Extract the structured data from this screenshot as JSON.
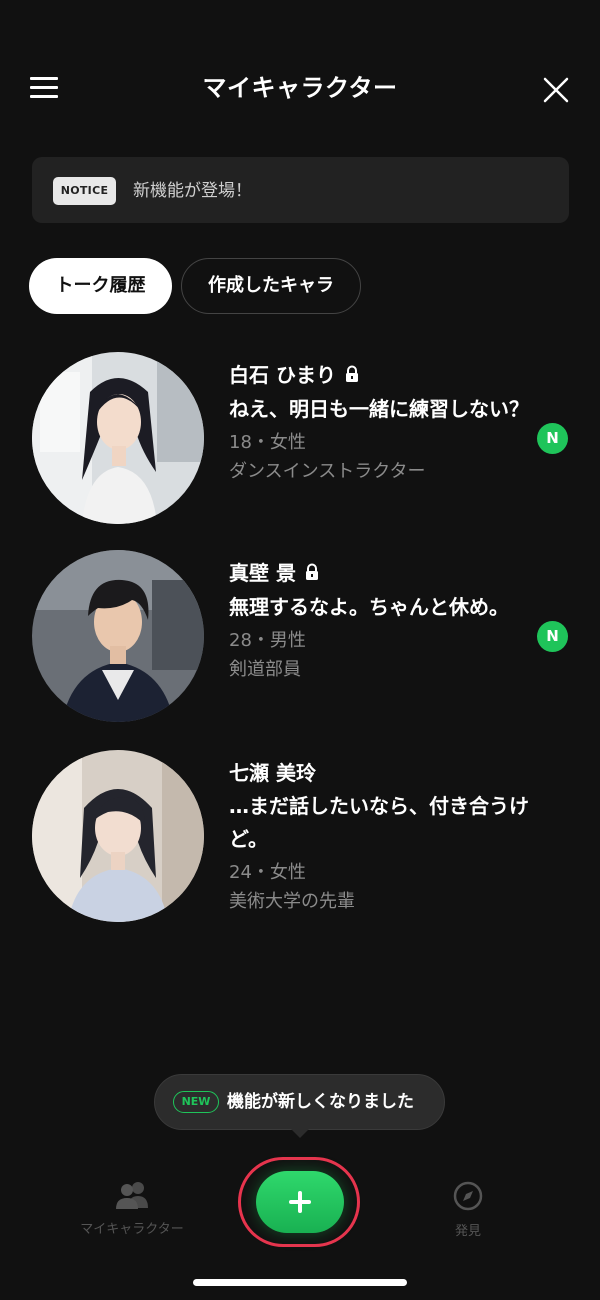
{
  "header": {
    "title": "マイキャラクター",
    "menu_icon": "hamburger-menu-icon",
    "close_icon": "close-icon"
  },
  "notice": {
    "badge": "NOTICE",
    "text": "新機能が登場！"
  },
  "tabs": [
    {
      "label": "トーク履歴",
      "active": true
    },
    {
      "label": "作成したキャラ",
      "active": false
    }
  ],
  "characters": [
    {
      "name": "白石 ひまり",
      "locked": true,
      "message": "ねえ、明日も一緒に練習しない？",
      "age_gender": "18・女性",
      "role": "ダンスインストラクター",
      "badge": "N"
    },
    {
      "name": "真壁 景",
      "locked": true,
      "message": "無理するなよ。ちゃんと休め。",
      "age_gender": "28・男性",
      "role": "剣道部員",
      "badge": "N"
    },
    {
      "name": "七瀬 美玲",
      "locked": false,
      "message": "…まだ話したいなら、付き合うけど。",
      "age_gender": "24・女性",
      "role": "美術大学の先輩",
      "badge": ""
    }
  ],
  "tooltip": {
    "badge": "NEW",
    "text": "機能が新しくなりました"
  },
  "bottom_nav": {
    "my_characters": {
      "label": "マイキャラクター",
      "icon": "people-icon"
    },
    "create": {
      "icon": "plus-icon"
    },
    "discover": {
      "label": "発見",
      "icon": "compass-icon"
    }
  },
  "colors": {
    "background": "#111111",
    "accent_green": "#1fc45a",
    "highlight_ring": "#e8344e"
  }
}
